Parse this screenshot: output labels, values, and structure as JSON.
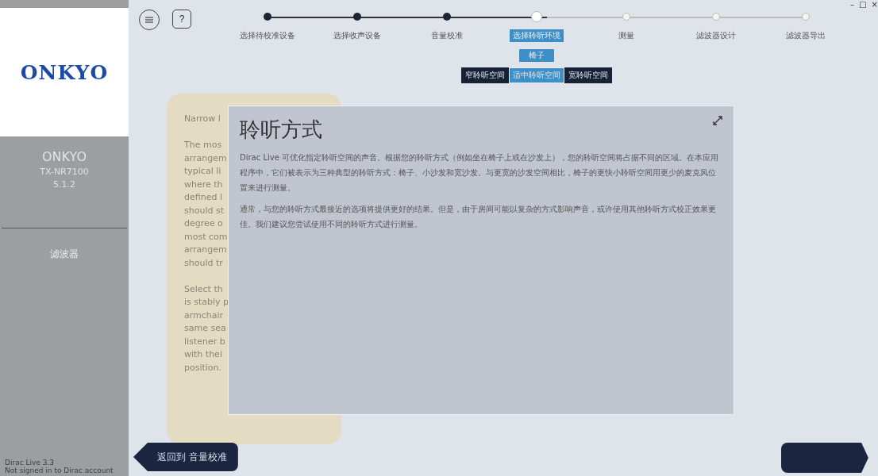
{
  "sidebar": {
    "logo_text": "ONKYO",
    "brand": "ONKYO",
    "model": "TX-NR7100",
    "config": "5.1.2",
    "items": [
      {
        "label": "滤波器",
        "selected": false
      }
    ],
    "footer": [
      "Dirac Live 3.3",
      "Not signed in to Dirac account"
    ]
  },
  "toolbar": {
    "help": "?"
  },
  "window_controls": [
    "–",
    "□",
    "×"
  ],
  "steps": [
    {
      "label": "选择待校准设备",
      "completed": true,
      "selected": false
    },
    {
      "label": "选择收声设备",
      "completed": true,
      "selected": false
    },
    {
      "label": "音量校准",
      "completed": true,
      "selected": false
    },
    {
      "label": "选择聆听环境",
      "completed": false,
      "selected": true,
      "sub_label": "椅子",
      "options": [
        {
          "label": "窄聆听空间",
          "selected": false
        },
        {
          "label": "适中聆听空间",
          "selected": true
        },
        {
          "label": "宽聆听空间",
          "selected": false
        }
      ]
    },
    {
      "label": "测量",
      "completed": false,
      "selected": false
    },
    {
      "label": "滤波器设计",
      "completed": false,
      "selected": false
    },
    {
      "label": "滤波器导出",
      "completed": false,
      "selected": false
    }
  ],
  "info_card": {
    "paragraphs": [
      [
        "Narrow l"
      ],
      [
        "The mos",
        "arrangem",
        "typical li",
        "where th",
        "defined l",
        "should st",
        "degree o",
        "most com",
        "arrangem",
        "should tr"
      ],
      [
        "Select th",
        "is stably p",
        "armchair",
        "same sea",
        "listener b",
        "with thei",
        "position."
      ]
    ]
  },
  "modal": {
    "title": "聆听方式",
    "paragraphs": [
      "Dirac Live 可优化指定聆听空间的声音。根据您的聆听方式（例如坐在椅子上或在沙发上），您的聆听空间将占据不同的区域。在本应用程序中，它们被表示为三种典型的聆听方式：椅子、小沙发和宽沙发。与更宽的沙发空间相比，椅子的更快小聆听空间用更少的麦克风位置来进行测量。",
      "通常，与您的聆听方式最接近的选项将提供更好的结果。但是，由于房间可能以复杂的方式影响声音，或许使用其他聆听方式校正效果更佳。我们建议您尝试使用不同的聆听方式进行测量。"
    ]
  },
  "back_button": "返回到 音量校准"
}
